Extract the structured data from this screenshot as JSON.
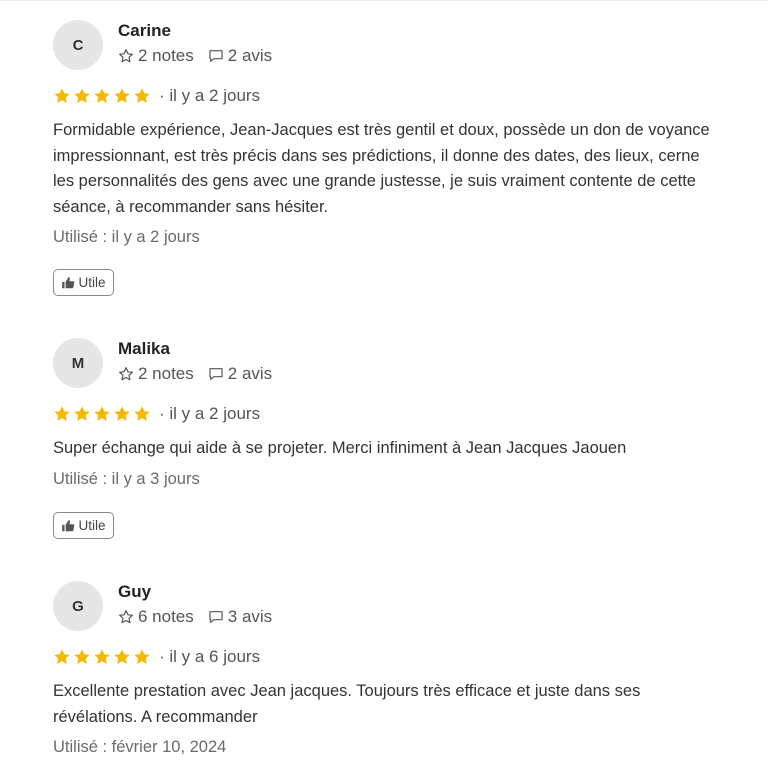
{
  "reviews": [
    {
      "initial": "C",
      "name": "Carine",
      "notes": "2 notes",
      "avis": "2 avis",
      "rating": 5,
      "when": "· il y a 2 jours",
      "text": "Formidable expérience, Jean-Jacques est très gentil et doux, possède un don de voyance impressionnant, est très précis dans ses prédictions, il donne des dates, des lieux, cerne les personnalités des gens avec une grande justesse, je suis vraiment contente de cette séance, à recommander sans hésiter.",
      "used": "Utilisé : il y a 2 jours",
      "helpful_label": "Utile"
    },
    {
      "initial": "M",
      "name": "Malika",
      "notes": "2 notes",
      "avis": "2 avis",
      "rating": 5,
      "when": "· il y a 2 jours",
      "text": "Super échange qui aide à se projeter. Merci infiniment à Jean Jacques Jaouen",
      "used": "Utilisé : il y a 3 jours",
      "helpful_label": "Utile"
    },
    {
      "initial": "G",
      "name": "Guy",
      "notes": "6 notes",
      "avis": "3 avis",
      "rating": 5,
      "when": "· il y a 6 jours",
      "text": "Excellente prestation avec Jean jacques. Toujours très efficace et juste dans ses révélations. A recommander",
      "used": "Utilisé : février 10, 2024"
    }
  ],
  "colors": {
    "star": "#f5b800",
    "avatar_bg": "#e6e6e6"
  },
  "icons": {
    "notes": "star-outline-icon",
    "avis": "comment-icon",
    "helpful": "thumbs-up-icon",
    "rating": "star-icon"
  }
}
